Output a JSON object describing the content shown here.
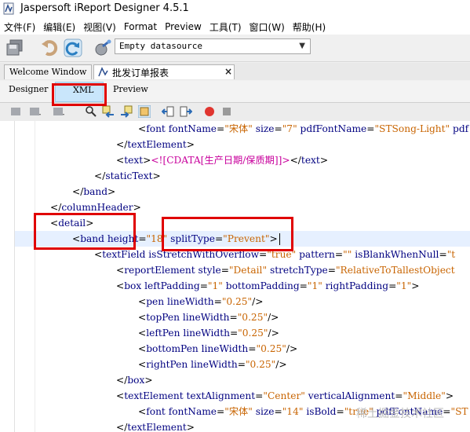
{
  "window": {
    "title": "Jaspersoft iReport Designer 4.5.1"
  },
  "menubar": {
    "items": [
      "文件(F)",
      "编辑(E)",
      "视图(V)",
      "Format",
      "Preview",
      "工具(T)",
      "窗口(W)",
      "帮助(H)"
    ]
  },
  "toolbar": {
    "datasource_value": "Empty datasource"
  },
  "tabs": [
    {
      "label": "Welcome Window"
    },
    {
      "label": "批发订单报表"
    }
  ],
  "subtabs": [
    "Designer",
    "XML",
    "Preview"
  ],
  "code": [
    [
      [
        "text",
        "<"
      ],
      [
        "tag",
        "font"
      ],
      [
        "text",
        " "
      ],
      [
        "attr",
        "fontName"
      ],
      [
        "text",
        "="
      ],
      [
        "val",
        "\"宋体\""
      ],
      [
        "text",
        " "
      ],
      [
        "attr",
        "size"
      ],
      [
        "text",
        "="
      ],
      [
        "val",
        "\"7\""
      ],
      [
        "text",
        " "
      ],
      [
        "attr",
        "pdfFontName"
      ],
      [
        "text",
        "="
      ],
      [
        "val",
        "\"STSong-Light\""
      ],
      [
        "text",
        " "
      ],
      [
        "attr",
        "pdf"
      ]
    ],
    [
      [
        "text",
        "</"
      ],
      [
        "tag",
        "textElement"
      ],
      [
        "text",
        ">"
      ]
    ],
    [
      [
        "text",
        "<"
      ],
      [
        "tag",
        "text"
      ],
      [
        "text",
        ">"
      ],
      [
        "cdata",
        "<![CDATA[生产日期/保质期]]>"
      ],
      [
        "text",
        "</"
      ],
      [
        "tag",
        "text"
      ],
      [
        "text",
        ">"
      ]
    ],
    [
      [
        "text",
        "</"
      ],
      [
        "tag",
        "staticText"
      ],
      [
        "text",
        ">"
      ]
    ],
    [
      [
        "text",
        "</"
      ],
      [
        "tag",
        "band"
      ],
      [
        "text",
        ">"
      ]
    ],
    [
      [
        "text",
        "</"
      ],
      [
        "tag",
        "columnHeader"
      ],
      [
        "text",
        ">"
      ]
    ],
    [
      [
        "text",
        "<"
      ],
      [
        "tag",
        "detail"
      ],
      [
        "text",
        ">"
      ]
    ],
    [
      [
        "text",
        "<"
      ],
      [
        "tag",
        "band"
      ],
      [
        "text",
        " "
      ],
      [
        "attr",
        "height"
      ],
      [
        "text",
        "="
      ],
      [
        "val",
        "\"18\""
      ],
      [
        "text",
        " "
      ],
      [
        "attr",
        "splitType"
      ],
      [
        "text",
        "="
      ],
      [
        "val",
        "\"Prevent\""
      ],
      [
        "text",
        ">"
      ]
    ],
    [
      [
        "text",
        "<"
      ],
      [
        "tag",
        "textField"
      ],
      [
        "text",
        " "
      ],
      [
        "attr",
        "isStretchWithOverflow"
      ],
      [
        "text",
        "="
      ],
      [
        "val",
        "\"true\""
      ],
      [
        "text",
        " "
      ],
      [
        "attr",
        "pattern"
      ],
      [
        "text",
        "="
      ],
      [
        "val",
        "\"\""
      ],
      [
        "text",
        " "
      ],
      [
        "attr",
        "isBlankWhenNull"
      ],
      [
        "text",
        "="
      ],
      [
        "val",
        "\"t"
      ]
    ],
    [
      [
        "text",
        "<"
      ],
      [
        "tag",
        "reportElement"
      ],
      [
        "text",
        " "
      ],
      [
        "attr",
        "style"
      ],
      [
        "text",
        "="
      ],
      [
        "val",
        "\"Detail\""
      ],
      [
        "text",
        " "
      ],
      [
        "attr",
        "stretchType"
      ],
      [
        "text",
        "="
      ],
      [
        "val",
        "\"RelativeToTallestObject"
      ]
    ],
    [
      [
        "text",
        "<"
      ],
      [
        "tag",
        "box"
      ],
      [
        "text",
        " "
      ],
      [
        "attr",
        "leftPadding"
      ],
      [
        "text",
        "="
      ],
      [
        "val",
        "\"1\""
      ],
      [
        "text",
        " "
      ],
      [
        "attr",
        "bottomPadding"
      ],
      [
        "text",
        "="
      ],
      [
        "val",
        "\"1\""
      ],
      [
        "text",
        " "
      ],
      [
        "attr",
        "rightPadding"
      ],
      [
        "text",
        "="
      ],
      [
        "val",
        "\"1\""
      ],
      [
        "text",
        ">"
      ]
    ],
    [
      [
        "text",
        "<"
      ],
      [
        "tag",
        "pen"
      ],
      [
        "text",
        " "
      ],
      [
        "attr",
        "lineWidth"
      ],
      [
        "text",
        "="
      ],
      [
        "val",
        "\"0.25\""
      ],
      [
        "text",
        "/>"
      ]
    ],
    [
      [
        "text",
        "<"
      ],
      [
        "tag",
        "topPen"
      ],
      [
        "text",
        " "
      ],
      [
        "attr",
        "lineWidth"
      ],
      [
        "text",
        "="
      ],
      [
        "val",
        "\"0.25\""
      ],
      [
        "text",
        "/>"
      ]
    ],
    [
      [
        "text",
        "<"
      ],
      [
        "tag",
        "leftPen"
      ],
      [
        "text",
        " "
      ],
      [
        "attr",
        "lineWidth"
      ],
      [
        "text",
        "="
      ],
      [
        "val",
        "\"0.25\""
      ],
      [
        "text",
        "/>"
      ]
    ],
    [
      [
        "text",
        "<"
      ],
      [
        "tag",
        "bottomPen"
      ],
      [
        "text",
        " "
      ],
      [
        "attr",
        "lineWidth"
      ],
      [
        "text",
        "="
      ],
      [
        "val",
        "\"0.25\""
      ],
      [
        "text",
        "/>"
      ]
    ],
    [
      [
        "text",
        "<"
      ],
      [
        "tag",
        "rightPen"
      ],
      [
        "text",
        " "
      ],
      [
        "attr",
        "lineWidth"
      ],
      [
        "text",
        "="
      ],
      [
        "val",
        "\"0.25\""
      ],
      [
        "text",
        "/>"
      ]
    ],
    [
      [
        "text",
        "</"
      ],
      [
        "tag",
        "box"
      ],
      [
        "text",
        ">"
      ]
    ],
    [
      [
        "text",
        "<"
      ],
      [
        "tag",
        "textElement"
      ],
      [
        "text",
        " "
      ],
      [
        "attr",
        "textAlignment"
      ],
      [
        "text",
        "="
      ],
      [
        "val",
        "\"Center\""
      ],
      [
        "text",
        " "
      ],
      [
        "attr",
        "verticalAlignment"
      ],
      [
        "text",
        "="
      ],
      [
        "val",
        "\"Middle\""
      ],
      [
        "text",
        ">"
      ]
    ],
    [
      [
        "text",
        "<"
      ],
      [
        "tag",
        "font"
      ],
      [
        "text",
        " "
      ],
      [
        "attr",
        "fontName"
      ],
      [
        "text",
        "="
      ],
      [
        "val",
        "\"宋体\""
      ],
      [
        "text",
        " "
      ],
      [
        "attr",
        "size"
      ],
      [
        "text",
        "="
      ],
      [
        "val",
        "\"14\""
      ],
      [
        "text",
        " "
      ],
      [
        "attr",
        "isBold"
      ],
      [
        "text",
        "="
      ],
      [
        "val",
        "\"true\""
      ],
      [
        "text",
        " "
      ],
      [
        "attr",
        "pdfFontName"
      ],
      [
        "text",
        "="
      ],
      [
        "val",
        "\"ST"
      ]
    ],
    [
      [
        "text",
        "</"
      ],
      [
        "tag",
        "textElement"
      ],
      [
        "text",
        ">"
      ]
    ]
  ],
  "watermark": "稀土掘金技术社区",
  "colors": {
    "highlight_box": "#e00000",
    "xml_tab_bg": "#c9e6fb",
    "tag": "#000080",
    "value": "#c86400",
    "cdata": "#c8009c"
  }
}
